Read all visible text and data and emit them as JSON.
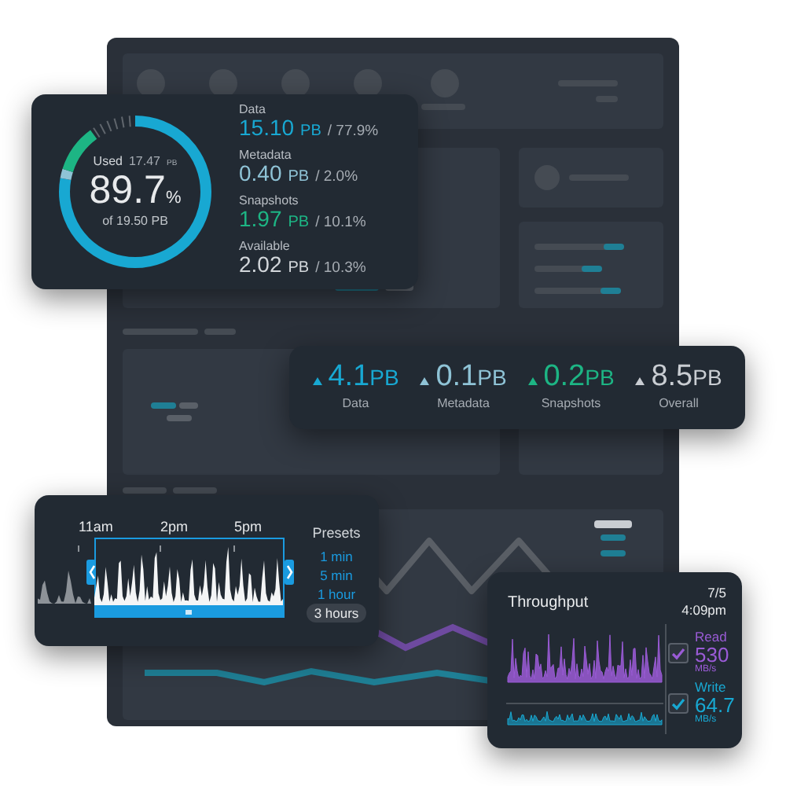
{
  "storage": {
    "used_label": "Used",
    "used_value": "17.47",
    "used_unit": "PB",
    "percent": "89.7",
    "percent_sign": "%",
    "total": "of 19.50 PB",
    "segments": [
      {
        "label": "Data",
        "value": "15.10",
        "unit": "PB",
        "share": "/ 77.9%",
        "color": "#18a8d2",
        "kind": "solid"
      },
      {
        "label": "Metadata",
        "value": "0.40",
        "unit": "PB",
        "share": "/ 2.0%",
        "color": "#8fc3d6",
        "kind": "solid"
      },
      {
        "label": "Snapshots",
        "value": "1.97",
        "unit": "PB",
        "share": "/ 10.1%",
        "color": "#1db584",
        "kind": "solid"
      },
      {
        "label": "Available",
        "value": "2.02",
        "unit": "PB",
        "share": "/ 10.3%",
        "color": "#d3d7db",
        "kind": "ticks"
      }
    ]
  },
  "growth": [
    {
      "value": "4.1",
      "unit": "PB",
      "label": "Data",
      "color": "#18a8d2"
    },
    {
      "value": "0.1",
      "unit": "PB",
      "label": "Metadata",
      "color": "#8fc3d6"
    },
    {
      "value": "0.2",
      "unit": "PB",
      "label": "Snapshots",
      "color": "#1db584"
    },
    {
      "value": "8.5",
      "unit": "PB",
      "label": "Overall",
      "color": "#c9cdd2"
    }
  ],
  "time_range": {
    "ticks": [
      "11am",
      "2pm",
      "5pm"
    ],
    "presets_title": "Presets",
    "presets": [
      {
        "label": "1 min",
        "selected": false
      },
      {
        "label": "5 min",
        "selected": false
      },
      {
        "label": "1 hour",
        "selected": false
      },
      {
        "label": "3 hours",
        "selected": true
      }
    ]
  },
  "throughput": {
    "title": "Throughput",
    "date": "7/5",
    "time": "4:09pm",
    "series": [
      {
        "name": "Read",
        "value": "530",
        "unit": "MB/s",
        "checked": true,
        "color": "#9a5bd6"
      },
      {
        "name": "Write",
        "value": "64.7",
        "unit": "MB/s",
        "checked": true,
        "color": "#18a8d2"
      }
    ]
  }
}
